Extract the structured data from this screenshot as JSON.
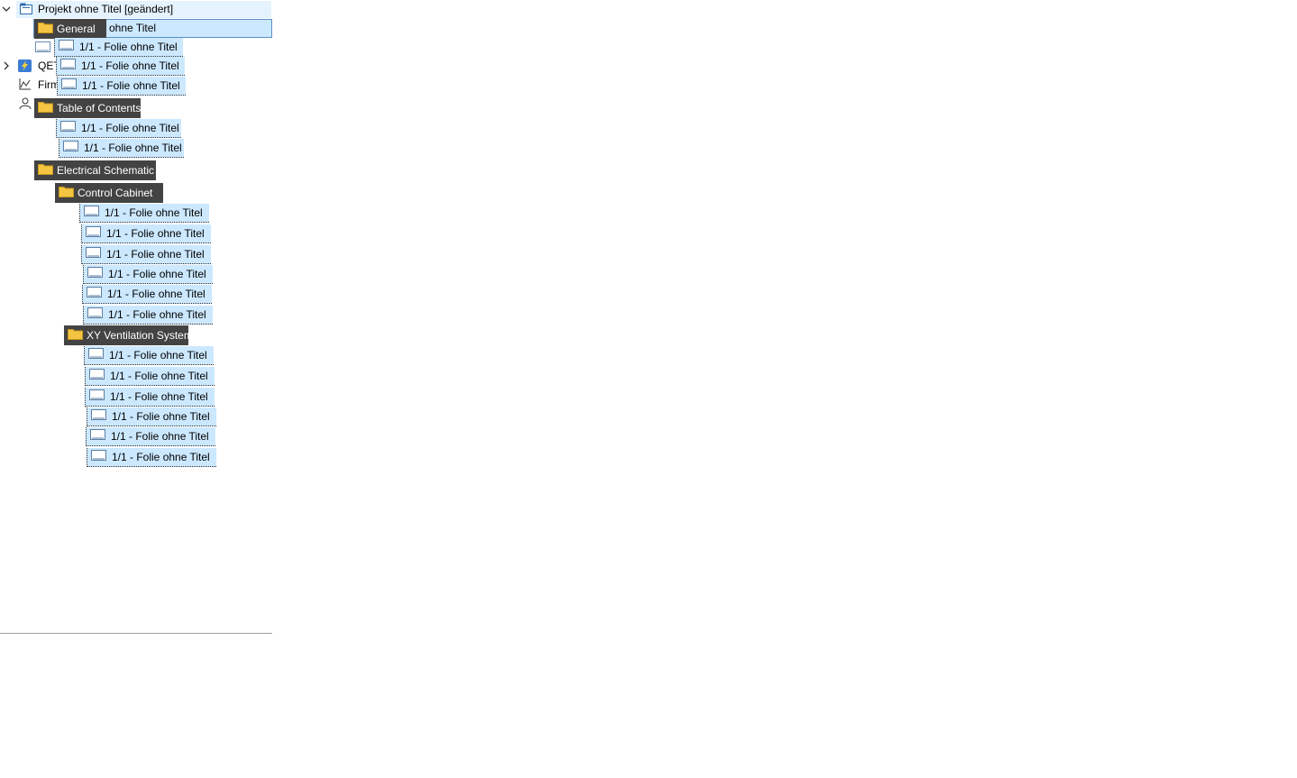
{
  "tree": {
    "root": {
      "label": "Projekt ohne Titel [geändert]",
      "expanded": true
    },
    "edit_field": {
      "value": "ohne Titel"
    },
    "side_items": [
      {
        "label": "QET"
      },
      {
        "label": "Firm"
      }
    ],
    "general": {
      "label": "General",
      "pages": [
        "1/1 - Folie ohne Titel",
        "1/1 - Folie ohne Titel",
        "1/1 - Folie ohne Titel"
      ]
    },
    "toc": {
      "label": "Table of Contents",
      "pages": [
        "1/1 - Folie ohne Titel",
        "1/1 - Folie ohne Titel"
      ]
    },
    "electrical": {
      "label": "Electrical Schematic"
    },
    "control_cabinet": {
      "label": "Control Cabinet",
      "pages": [
        "1/1 - Folie ohne Titel",
        "1/1 - Folie ohne Titel",
        "1/1 - Folie ohne Titel",
        "1/1 - Folie ohne Titel",
        "1/1 - Folie ohne Titel",
        "1/1 - Folie ohne Titel"
      ]
    },
    "ventilation": {
      "label": "XY Ventilation System",
      "pages": [
        "1/1 - Folie ohne Titel",
        "1/1 - Folie ohne Titel",
        "1/1 - Folie ohne Titel",
        "1/1 - Folie ohne Titel",
        "1/1 - Folie ohne Titel",
        "1/1 - Folie ohne Titel"
      ]
    }
  },
  "colors": {
    "selection": "#cce8ff",
    "drag_folder": "#434343",
    "folder_yellow": "#f4c542"
  }
}
